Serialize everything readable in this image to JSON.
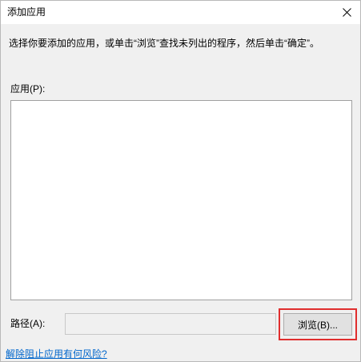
{
  "dialog": {
    "title": "添加应用",
    "instruction": "选择你要添加的应用，或单击“浏览”查找未列出的程序，然后单击“确定”。"
  },
  "apps": {
    "label": "应用(P):",
    "items": []
  },
  "path": {
    "label": "路径(A):",
    "value": ""
  },
  "buttons": {
    "browse_label": "浏览(B)...",
    "close_icon": "close-icon"
  },
  "link": {
    "risk_text": "解除阻止应用有何风险?"
  },
  "colors": {
    "dialog_bg": "#f0f0f0",
    "titlebar_bg": "#ffffff",
    "list_bg": "#ffffff",
    "highlight_border": "#e02e2e",
    "link_color": "#0066cc"
  }
}
